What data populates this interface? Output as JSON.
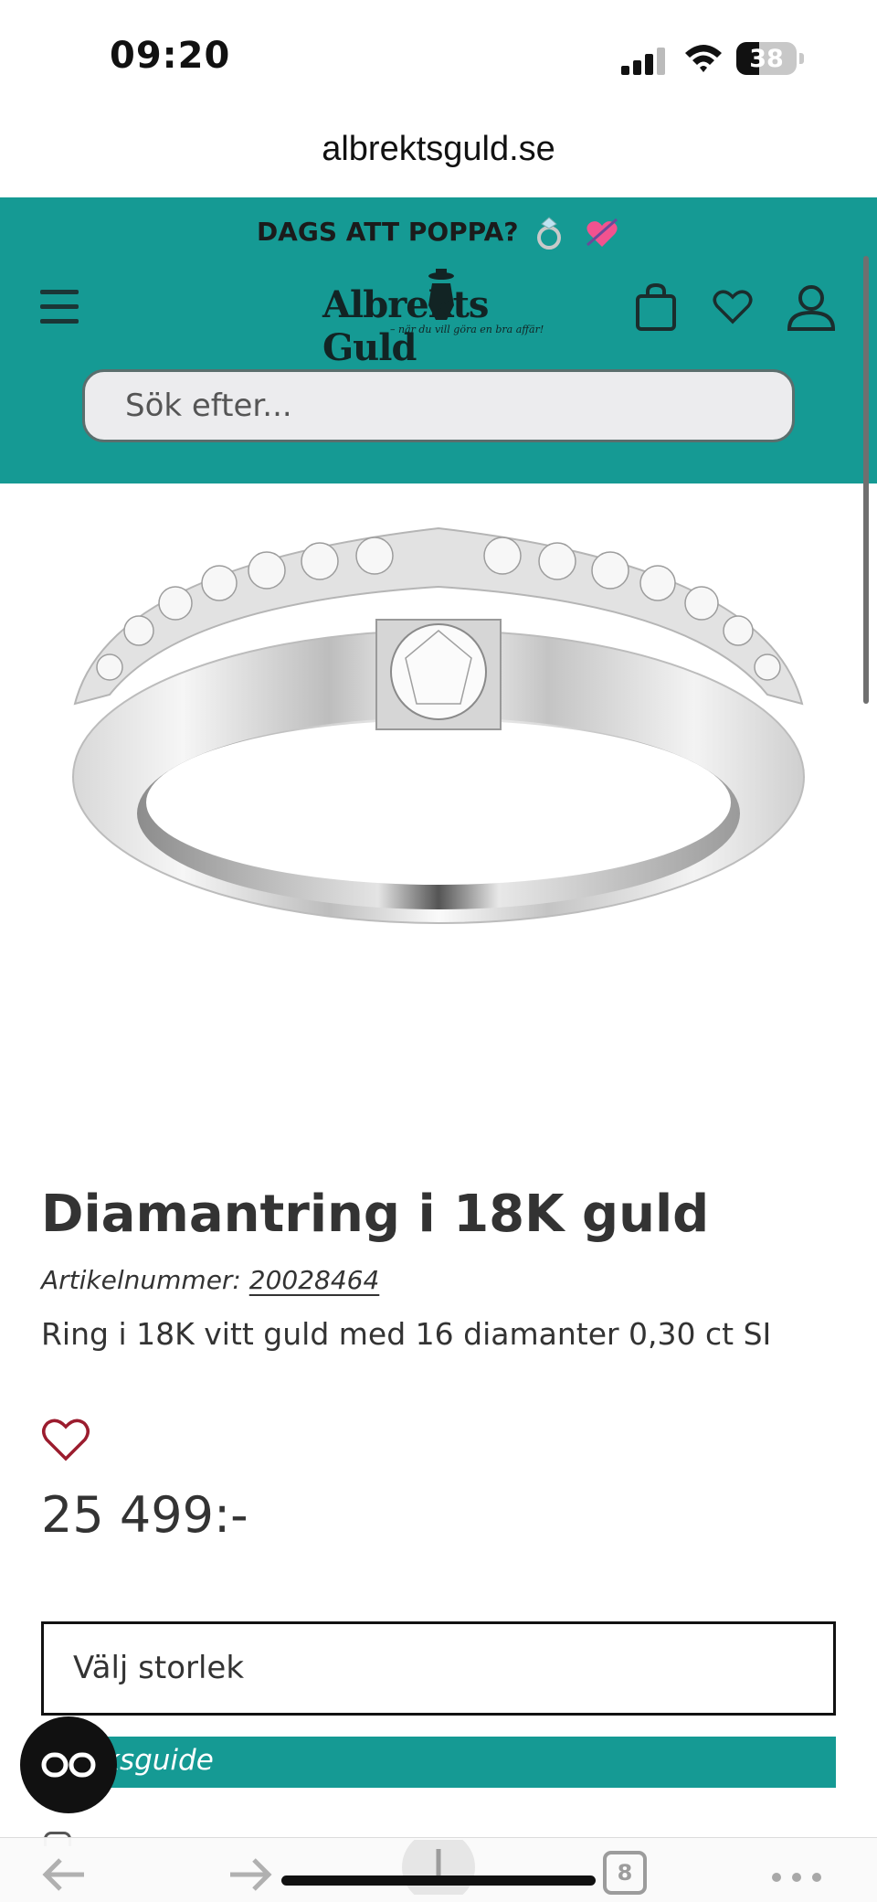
{
  "status_bar": {
    "time": "09:20",
    "battery": "38",
    "battery_level": 0.38
  },
  "browser": {
    "url": "albrektsguld.se",
    "tab_count": "8"
  },
  "header": {
    "promo_text": "DAGS ATT POPPA?",
    "logo_text": "Albrekts Guld",
    "logo_tagline": "– när du vill göra en bra affär!",
    "search_placeholder": "Sök efter..."
  },
  "product": {
    "title": "Diamantring i 18K guld",
    "article_label": "Artikelnummer:",
    "article_number": "20028464",
    "description": "Ring i 18K vitt guld med 16 diamanter 0,30 ct SI",
    "price": "25 499:-",
    "size_select_label": "Välj storlek",
    "size_guide_label": "ksguide"
  },
  "colors": {
    "brand_teal": "#159a94",
    "heart_red": "#9b1c2e",
    "text": "#333333"
  },
  "icons": [
    "hamburger-menu-icon",
    "shopping-bag-icon",
    "heart-icon",
    "user-icon",
    "back-arrow-icon",
    "forward-arrow-icon",
    "share-icon",
    "more-icon",
    "reader-glasses-icon"
  ]
}
